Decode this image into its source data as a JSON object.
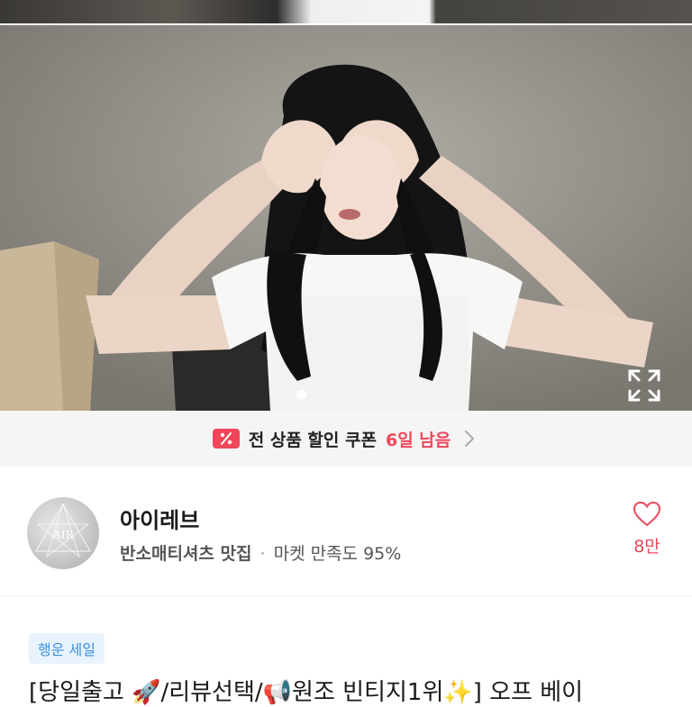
{
  "photo": {
    "alt": "product-photo",
    "icons": {
      "expand": "expand-icon"
    }
  },
  "coupon": {
    "icon": "coupon-percent-icon",
    "label": "전 상품 할인 쿠폰",
    "days_left": "6일 남음",
    "chevron": "chevron-right-icon"
  },
  "seller": {
    "name": "아이레브",
    "tagline": "반소매티셔츠 맛집",
    "separator": "·",
    "satisfaction": "마켓 만족도 95%",
    "like_count": "8만"
  },
  "product": {
    "badge": "행운 세일",
    "title": "[당일출고 🚀/리뷰선택/📢원조 빈티지1위✨] 오프 베이"
  },
  "colors": {
    "accent": "#f0465a",
    "badge_bg": "#e9f3fd",
    "badge_text": "#3d8fe0"
  }
}
